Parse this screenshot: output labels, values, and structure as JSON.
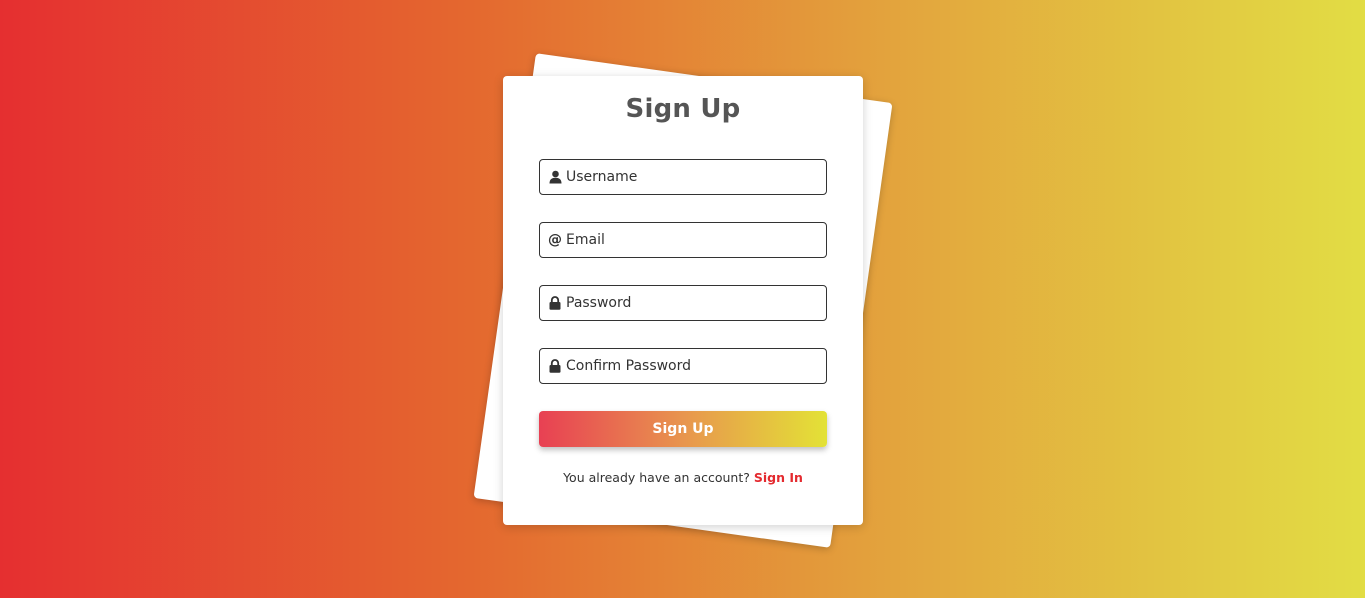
{
  "form": {
    "title": "Sign Up",
    "fields": {
      "username": {
        "placeholder": "Username",
        "icon": "user-icon"
      },
      "email": {
        "placeholder": "Email",
        "icon": "at-icon",
        "icon_glyph": "@"
      },
      "password": {
        "placeholder": "Password",
        "icon": "lock-icon"
      },
      "confirm_password": {
        "placeholder": "Confirm Password",
        "icon": "lock-icon"
      }
    },
    "submit_label": "Sign Up",
    "footer_text": "You already have an account?",
    "signin_link": "Sign In"
  },
  "colors": {
    "background_gradient": [
      "#e52f30",
      "#e2dd44"
    ],
    "button_gradient": [
      "#e84053",
      "#e3e236"
    ],
    "link": "#e42a2f",
    "title": "#555555"
  }
}
